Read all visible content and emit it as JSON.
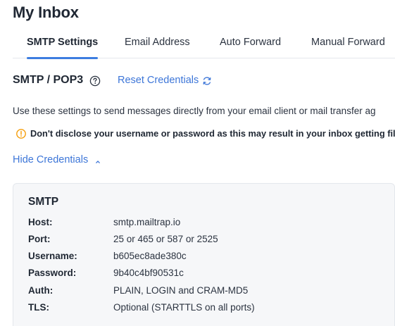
{
  "header": {
    "title": "My Inbox"
  },
  "tabs": [
    {
      "label": "SMTP Settings",
      "active": true
    },
    {
      "label": "Email Address",
      "active": false
    },
    {
      "label": "Auto Forward",
      "active": false
    },
    {
      "label": "Manual Forward",
      "active": false
    }
  ],
  "section": {
    "title": "SMTP / POP3",
    "help_icon": "question-circle-icon",
    "reset_label": "Reset Credentials",
    "reset_icon": "refresh-icon"
  },
  "description": "Use these settings to send messages directly from your email client or mail transfer ag",
  "warning": {
    "icon": "warning-icon",
    "text": "Don't disclose your username or password as this may result in your inbox getting filled",
    "color": "#f59e0b"
  },
  "toggle": {
    "label": "Hide Credentials",
    "icon": "chevron-up-icon"
  },
  "smtp": {
    "title": "SMTP",
    "rows": [
      {
        "label": "Host:",
        "value": "smtp.mailtrap.io"
      },
      {
        "label": "Port:",
        "value": "25 or 465 or 587 or 2525"
      },
      {
        "label": "Username:",
        "value": "b605ec8ade380c"
      },
      {
        "label": "Password:",
        "value": "9b40c4bf90531c"
      },
      {
        "label": "Auth:",
        "value": "PLAIN, LOGIN and CRAM-MD5"
      },
      {
        "label": "TLS:",
        "value": "Optional (STARTTLS on all ports)"
      }
    ]
  },
  "colors": {
    "accent": "#3d7de0",
    "link": "#3d76d8",
    "card_bg": "#f6f7f9"
  }
}
